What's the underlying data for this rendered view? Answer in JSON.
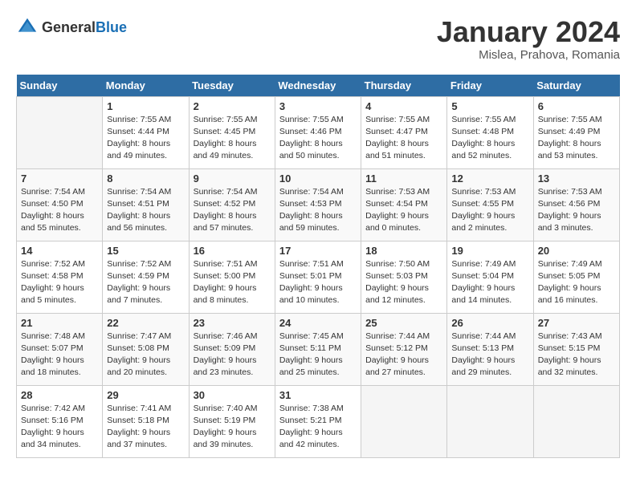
{
  "header": {
    "logo_general": "General",
    "logo_blue": "Blue",
    "title": "January 2024",
    "subtitle": "Mislea, Prahova, Romania"
  },
  "days_of_week": [
    "Sunday",
    "Monday",
    "Tuesday",
    "Wednesday",
    "Thursday",
    "Friday",
    "Saturday"
  ],
  "weeks": [
    [
      {
        "day": "",
        "info": ""
      },
      {
        "day": "1",
        "info": "Sunrise: 7:55 AM\nSunset: 4:44 PM\nDaylight: 8 hours\nand 49 minutes."
      },
      {
        "day": "2",
        "info": "Sunrise: 7:55 AM\nSunset: 4:45 PM\nDaylight: 8 hours\nand 49 minutes."
      },
      {
        "day": "3",
        "info": "Sunrise: 7:55 AM\nSunset: 4:46 PM\nDaylight: 8 hours\nand 50 minutes."
      },
      {
        "day": "4",
        "info": "Sunrise: 7:55 AM\nSunset: 4:47 PM\nDaylight: 8 hours\nand 51 minutes."
      },
      {
        "day": "5",
        "info": "Sunrise: 7:55 AM\nSunset: 4:48 PM\nDaylight: 8 hours\nand 52 minutes."
      },
      {
        "day": "6",
        "info": "Sunrise: 7:55 AM\nSunset: 4:49 PM\nDaylight: 8 hours\nand 53 minutes."
      }
    ],
    [
      {
        "day": "7",
        "info": "Sunrise: 7:54 AM\nSunset: 4:50 PM\nDaylight: 8 hours\nand 55 minutes."
      },
      {
        "day": "8",
        "info": "Sunrise: 7:54 AM\nSunset: 4:51 PM\nDaylight: 8 hours\nand 56 minutes."
      },
      {
        "day": "9",
        "info": "Sunrise: 7:54 AM\nSunset: 4:52 PM\nDaylight: 8 hours\nand 57 minutes."
      },
      {
        "day": "10",
        "info": "Sunrise: 7:54 AM\nSunset: 4:53 PM\nDaylight: 8 hours\nand 59 minutes."
      },
      {
        "day": "11",
        "info": "Sunrise: 7:53 AM\nSunset: 4:54 PM\nDaylight: 9 hours\nand 0 minutes."
      },
      {
        "day": "12",
        "info": "Sunrise: 7:53 AM\nSunset: 4:55 PM\nDaylight: 9 hours\nand 2 minutes."
      },
      {
        "day": "13",
        "info": "Sunrise: 7:53 AM\nSunset: 4:56 PM\nDaylight: 9 hours\nand 3 minutes."
      }
    ],
    [
      {
        "day": "14",
        "info": "Sunrise: 7:52 AM\nSunset: 4:58 PM\nDaylight: 9 hours\nand 5 minutes."
      },
      {
        "day": "15",
        "info": "Sunrise: 7:52 AM\nSunset: 4:59 PM\nDaylight: 9 hours\nand 7 minutes."
      },
      {
        "day": "16",
        "info": "Sunrise: 7:51 AM\nSunset: 5:00 PM\nDaylight: 9 hours\nand 8 minutes."
      },
      {
        "day": "17",
        "info": "Sunrise: 7:51 AM\nSunset: 5:01 PM\nDaylight: 9 hours\nand 10 minutes."
      },
      {
        "day": "18",
        "info": "Sunrise: 7:50 AM\nSunset: 5:03 PM\nDaylight: 9 hours\nand 12 minutes."
      },
      {
        "day": "19",
        "info": "Sunrise: 7:49 AM\nSunset: 5:04 PM\nDaylight: 9 hours\nand 14 minutes."
      },
      {
        "day": "20",
        "info": "Sunrise: 7:49 AM\nSunset: 5:05 PM\nDaylight: 9 hours\nand 16 minutes."
      }
    ],
    [
      {
        "day": "21",
        "info": "Sunrise: 7:48 AM\nSunset: 5:07 PM\nDaylight: 9 hours\nand 18 minutes."
      },
      {
        "day": "22",
        "info": "Sunrise: 7:47 AM\nSunset: 5:08 PM\nDaylight: 9 hours\nand 20 minutes."
      },
      {
        "day": "23",
        "info": "Sunrise: 7:46 AM\nSunset: 5:09 PM\nDaylight: 9 hours\nand 23 minutes."
      },
      {
        "day": "24",
        "info": "Sunrise: 7:45 AM\nSunset: 5:11 PM\nDaylight: 9 hours\nand 25 minutes."
      },
      {
        "day": "25",
        "info": "Sunrise: 7:44 AM\nSunset: 5:12 PM\nDaylight: 9 hours\nand 27 minutes."
      },
      {
        "day": "26",
        "info": "Sunrise: 7:44 AM\nSunset: 5:13 PM\nDaylight: 9 hours\nand 29 minutes."
      },
      {
        "day": "27",
        "info": "Sunrise: 7:43 AM\nSunset: 5:15 PM\nDaylight: 9 hours\nand 32 minutes."
      }
    ],
    [
      {
        "day": "28",
        "info": "Sunrise: 7:42 AM\nSunset: 5:16 PM\nDaylight: 9 hours\nand 34 minutes."
      },
      {
        "day": "29",
        "info": "Sunrise: 7:41 AM\nSunset: 5:18 PM\nDaylight: 9 hours\nand 37 minutes."
      },
      {
        "day": "30",
        "info": "Sunrise: 7:40 AM\nSunset: 5:19 PM\nDaylight: 9 hours\nand 39 minutes."
      },
      {
        "day": "31",
        "info": "Sunrise: 7:38 AM\nSunset: 5:21 PM\nDaylight: 9 hours\nand 42 minutes."
      },
      {
        "day": "",
        "info": ""
      },
      {
        "day": "",
        "info": ""
      },
      {
        "day": "",
        "info": ""
      }
    ]
  ]
}
